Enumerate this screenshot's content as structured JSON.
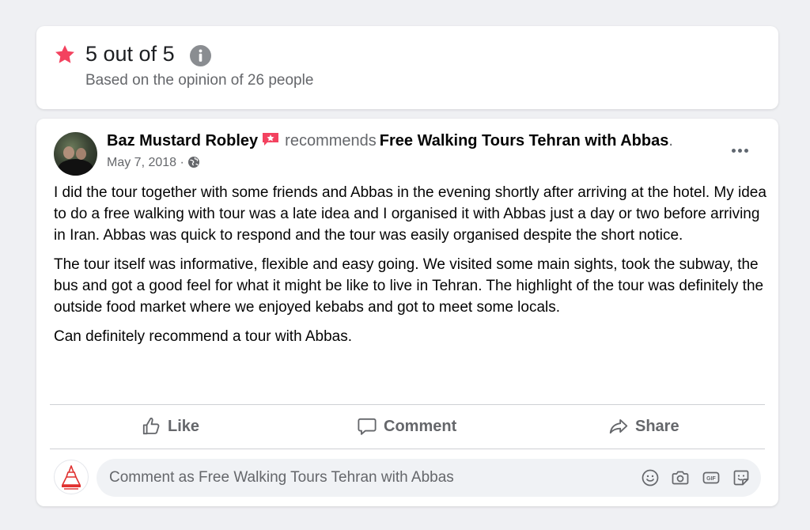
{
  "rating": {
    "title": "5 out of 5",
    "subtitle": "Based on the opinion of 26 people",
    "star_color": "#f3425f"
  },
  "post": {
    "author": "Baz Mustard Robley",
    "recommends_text": "recommends",
    "page_name": "Free Walking Tours Tehran with Abbas",
    "period": ".",
    "date": "May 7, 2018",
    "date_separator": "·",
    "paragraphs": [
      "I did the tour together with some friends and Abbas in the evening shortly after arriving at the hotel. My idea to do a free walking with tour was a late idea and I organised it with Abbas just a day or two before arriving in Iran. Abbas was quick to respond and the tour was easily organised despite the short notice.",
      "The tour itself was informative, flexible and easy going. We visited some main sights, took the subway, the bus and got a good feel for what it might be like to live in Tehran. The highlight of the tour was definitely the outside food market where we enjoyed kebabs and got to meet some locals.",
      "Can definitely recommend a tour with Abbas."
    ]
  },
  "actions": {
    "like": "Like",
    "comment": "Comment",
    "share": "Share"
  },
  "comment_box": {
    "placeholder": "Comment as Free Walking Tours Tehran with Abbas"
  },
  "icons": {
    "rating": "star-icon",
    "info": "info-icon",
    "recommend": "recommend-flag-icon",
    "audience": "globe-icon",
    "menu": "more-options-icon",
    "like": "thumbs-up-icon",
    "comment": "speech-bubble-icon",
    "share": "share-arrow-icon",
    "emoji": "emoji-icon",
    "camera": "camera-icon",
    "gif": "gif-icon",
    "sticker": "sticker-icon"
  }
}
